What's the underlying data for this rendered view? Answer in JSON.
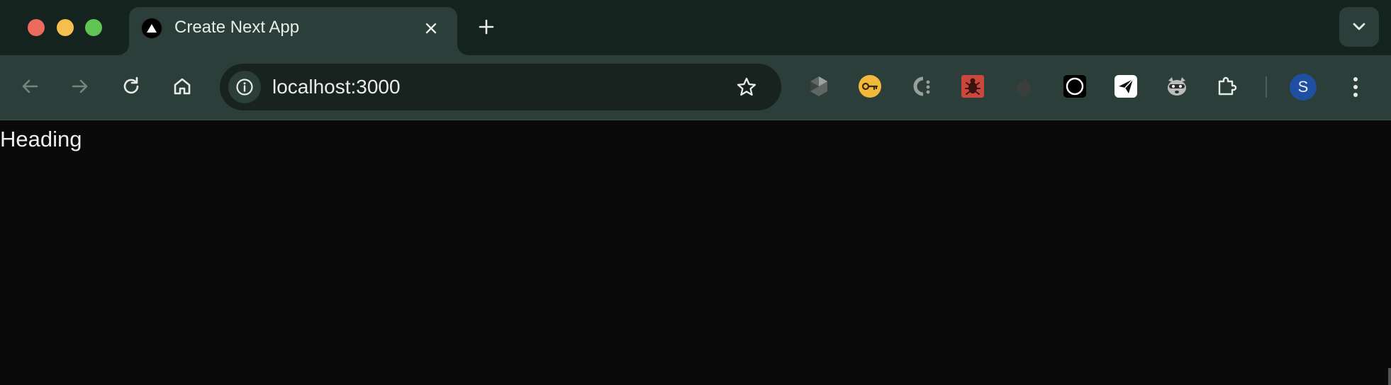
{
  "browser": {
    "tab": {
      "title": "Create Next App",
      "favicon": "nextjs-triangle-icon"
    },
    "toolbar": {
      "url": "localhost:3000"
    },
    "profile": {
      "initial": "S",
      "color": "#1f4fa0"
    },
    "extensions": [
      "hexagon-extension-icon",
      "key-extension-icon",
      "c-extension-icon",
      "bug-extension-icon",
      "flame-extension-icon",
      "circle-extension-icon",
      "paper-plane-extension-icon",
      "raccoon-extension-icon",
      "puzzle-extensions-icon"
    ],
    "colors": {
      "tabstrip": "#15231f",
      "toolbar": "#2b3e39",
      "page_background": "#0a0a0a"
    }
  },
  "page": {
    "heading": "Heading"
  }
}
